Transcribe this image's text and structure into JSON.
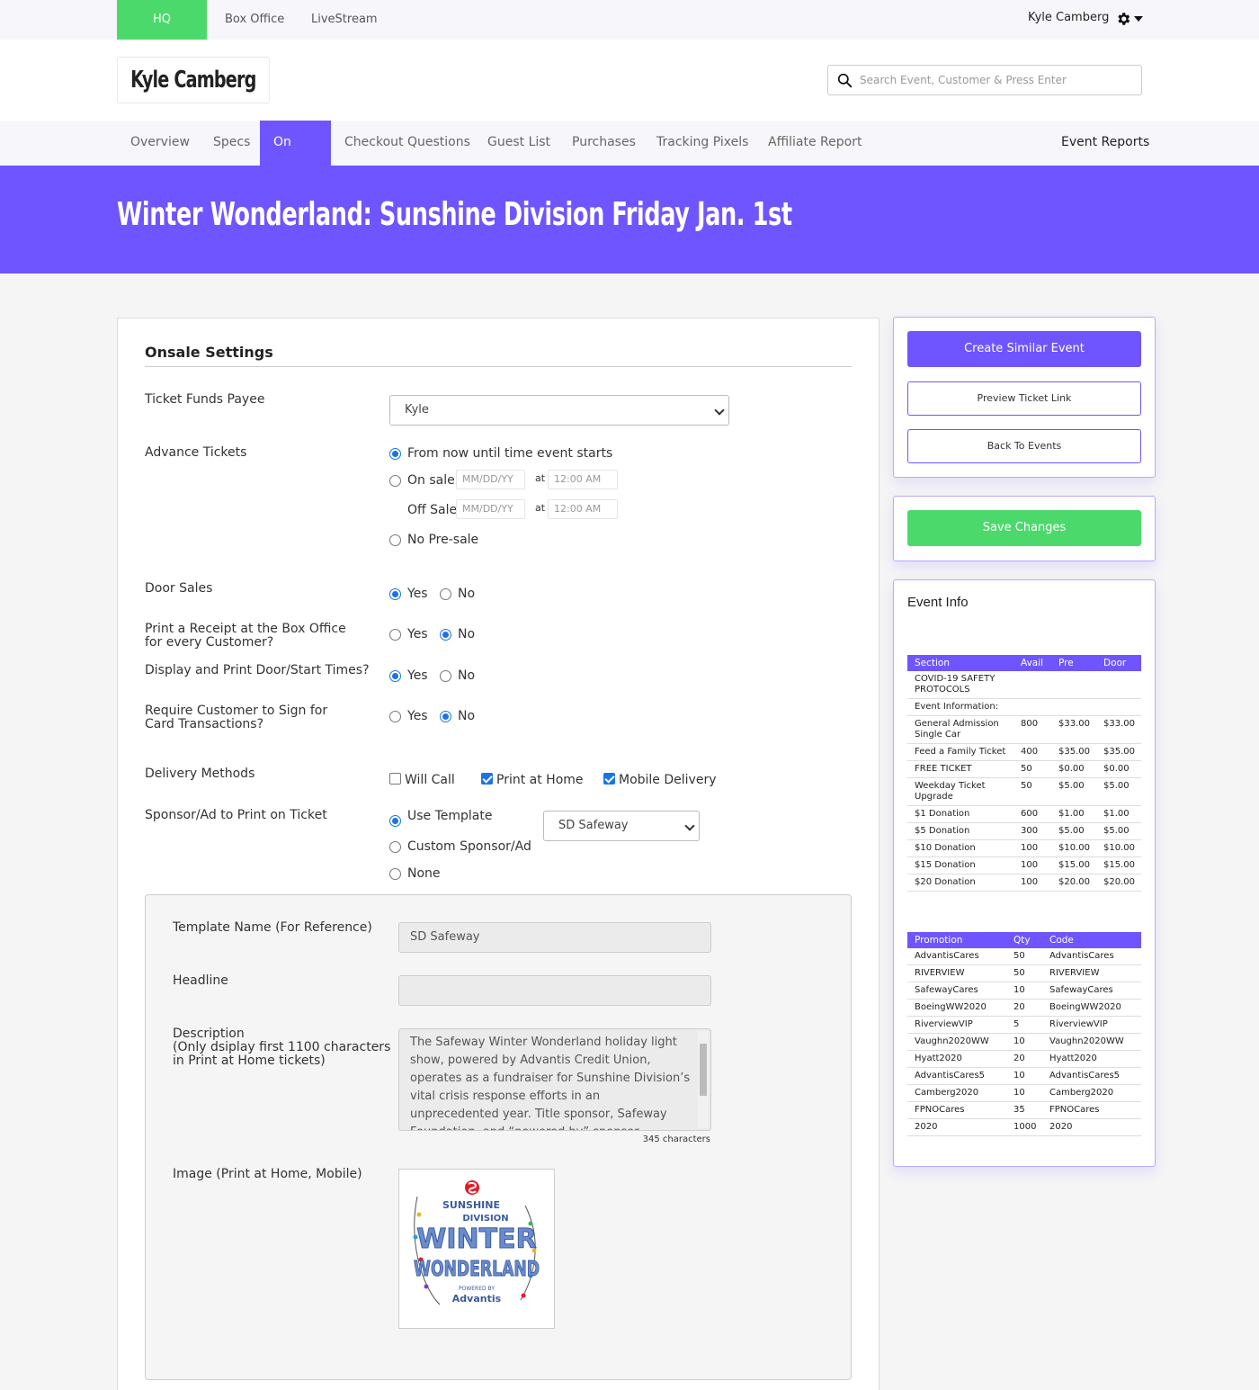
{
  "topbar": {
    "tabs": [
      "HQ",
      "Box Office",
      "LiveStream"
    ],
    "user": "Kyle Camberg"
  },
  "header": {
    "logo": "Kyle Camberg",
    "search_placeholder": "Search Event, Customer & Press Enter"
  },
  "nav": {
    "items": [
      "Overview",
      "Specs",
      "On Sale",
      "Checkout Questions",
      "Guest List",
      "Purchases",
      "Tracking Pixels",
      "Affiliate Report"
    ],
    "active": "On Sale",
    "reports": "Event Reports"
  },
  "event_title": "Winter Wonderland: Sunshine Division Friday Jan. 1st",
  "onsale": {
    "title": "Onsale Settings",
    "payee_label": "Ticket Funds Payee",
    "payee_value": "Kyle",
    "advance_label": "Advance Tickets",
    "advance_options": [
      "From now until time event starts",
      "On sale",
      "Off Sale",
      "No Pre-sale"
    ],
    "date_placeholder": "MM/DD/YY",
    "time_placeholder": "12:00 AM",
    "at": "at",
    "door_label": "Door Sales",
    "receipt_label": "Print a Receipt at the Box Office for every Customer?",
    "times_label": "Display and Print Door/Start Times?",
    "sign_label": "Require Customer to Sign for Card Transactions?",
    "yes": "Yes",
    "no": "No",
    "delivery_label": "Delivery Methods",
    "delivery_options": [
      "Will Call",
      "Print at Home",
      "Mobile Delivery"
    ],
    "sponsor_label": "Sponsor/Ad to Print on Ticket",
    "sponsor_options": [
      "Use Template",
      "Custom Sponsor/Ad",
      "None"
    ],
    "sponsor_select": "SD Safeway"
  },
  "template": {
    "name_label": "Template Name (For Reference)",
    "name_value": "SD Safeway",
    "headline_label": "Headline",
    "headline_value": "",
    "desc_label_1": "Description",
    "desc_label_2": "(Only dsiplay first 1100 characters",
    "desc_label_3": "in Print at Home tickets)",
    "desc_value": "The Safeway Winter Wonderland holiday light show, powered by Advantis Credit Union, operates as a fundraiser for Sunshine Division’s vital crisis response efforts in an unprecedented year. Title sponsor, Safeway Foundation, and “powered by” sponsor, Advantis Credit Union, provide significant",
    "chars": "345 characters",
    "image_label": "Image (Print at Home, Mobile)",
    "logo_text": {
      "line1": "SUNSHINE",
      "line2": "DIVISION",
      "line3": "WINTER",
      "line4": "WONDERLAND",
      "powered": "POWERED BY",
      "brand": "Advantis"
    }
  },
  "sidebar": {
    "create": "Create Similar Event",
    "preview": "Preview Ticket Link",
    "back": "Back To Events",
    "save": "Save Changes",
    "info_title": "Event Info",
    "section_headers": [
      "Section",
      "Avail",
      "Pre",
      "Door"
    ],
    "sections": [
      [
        "COVID-19 SAFETY PROTOCOLS",
        "",
        "",
        ""
      ],
      [
        "Event Information:",
        "",
        "",
        ""
      ],
      [
        "General Admission Single Car",
        "800",
        "$33.00",
        "$33.00"
      ],
      [
        "Feed a Family Ticket",
        "400",
        "$35.00",
        "$35.00"
      ],
      [
        "FREE TICKET",
        "50",
        "$0.00",
        "$0.00"
      ],
      [
        "Weekday Ticket Upgrade",
        "50",
        "$5.00",
        "$5.00"
      ],
      [
        "$1 Donation",
        "600",
        "$1.00",
        "$1.00"
      ],
      [
        "$5 Donation",
        "300",
        "$5.00",
        "$5.00"
      ],
      [
        "$10 Donation",
        "100",
        "$10.00",
        "$10.00"
      ],
      [
        "$15 Donation",
        "100",
        "$15.00",
        "$15.00"
      ],
      [
        "$20 Donation",
        "100",
        "$20.00",
        "$20.00"
      ]
    ],
    "promo_headers": [
      "Promotion",
      "Qty",
      "Code"
    ],
    "promos": [
      [
        "AdvantisCares",
        "50",
        "AdvantisCares"
      ],
      [
        "RIVERVIEW",
        "50",
        "RIVERVIEW"
      ],
      [
        "SafewayCares",
        "10",
        "SafewayCares"
      ],
      [
        "BoeingWW2020",
        "20",
        "BoeingWW2020"
      ],
      [
        "RiverviewVIP",
        "5",
        "RiverviewVIP"
      ],
      [
        "Vaughn2020WW",
        "10",
        "Vaughn2020WW"
      ],
      [
        "Hyatt2020",
        "20",
        "Hyatt2020"
      ],
      [
        "AdvantisCares5",
        "10",
        "AdvantisCares5"
      ],
      [
        "Camberg2020",
        "10",
        "Camberg2020"
      ],
      [
        "FPNOCares",
        "35",
        "FPNOCares"
      ],
      [
        "2020",
        "1000",
        "2020"
      ]
    ]
  },
  "colors": {
    "accent": "#6f55ff",
    "green": "#4cd96b",
    "radio": "#1a73e8"
  },
  "icons": [
    "search-icon",
    "gear-icon",
    "caret-down-icon",
    "chevron-down-icon"
  ]
}
